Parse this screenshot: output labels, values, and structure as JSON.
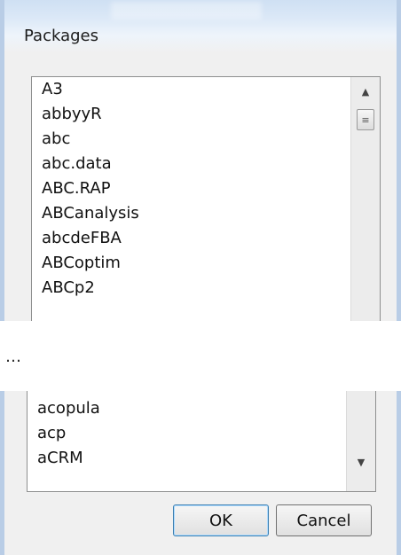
{
  "dialog": {
    "title": "Packages",
    "ok_label": "OK",
    "cancel_label": "Cancel",
    "ellipsis": "…"
  },
  "list_top": [
    "A3",
    "abbyyR",
    "abc",
    "abc.data",
    "ABC.RAP",
    "ABCanalysis",
    "abcdeFBA",
    "ABCoptim",
    "ABCp2"
  ],
  "list_bottom": [
    "acopula",
    "acp",
    "aCRM"
  ],
  "scrollbar": {
    "up_glyph": "▲",
    "down_glyph": "▼",
    "thumb_glyph": "≡"
  }
}
